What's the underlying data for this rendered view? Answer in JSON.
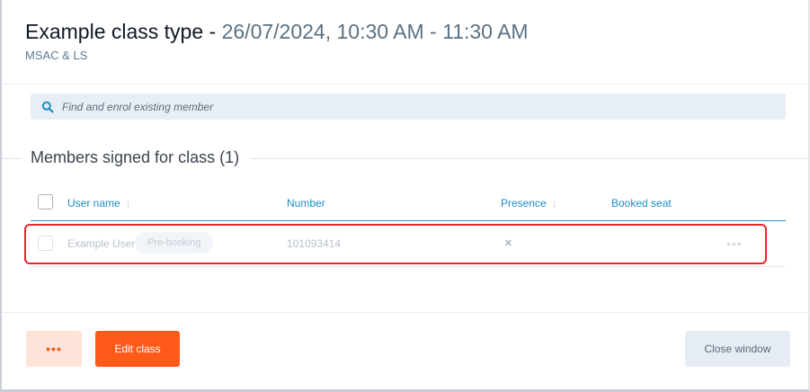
{
  "header": {
    "class_type": "Example class type - ",
    "datetime": "26/07/2024, 10:30 AM - 11:30 AM",
    "location": "MSAC & LS"
  },
  "search": {
    "placeholder": "Find and enrol existing member",
    "value": ""
  },
  "members_section": {
    "title": "Members signed for class (1)"
  },
  "table": {
    "columns": [
      {
        "label": "User name",
        "sortable": true
      },
      {
        "label": "Number",
        "sortable": false
      },
      {
        "label": "Presence",
        "sortable": true
      },
      {
        "label": "Booked seat",
        "sortable": false
      }
    ],
    "rows": [
      {
        "user_name": "Example User",
        "badge": "Pre-booking",
        "number": "101093414",
        "presence": "×",
        "booked_seat": "",
        "actions": "•••"
      }
    ]
  },
  "footer": {
    "more_label": "•••",
    "edit_label": "Edit class",
    "close_label": "Close window"
  },
  "icons": {
    "search": "search-icon",
    "sort": "arrow-down-icon",
    "presence": "close-icon",
    "row_actions": "more-horizontal-icon"
  },
  "colors": {
    "accent": "#ff5a1a",
    "link_blue": "#1b8fc4",
    "highlight_red": "#e8252b",
    "date_gray": "#5b7183"
  }
}
